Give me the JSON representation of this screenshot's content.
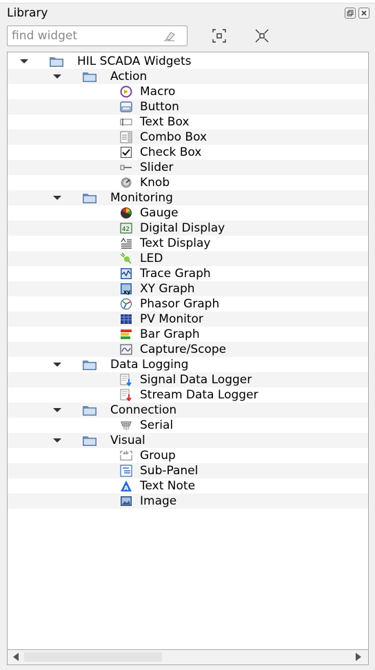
{
  "panel": {
    "title": "Library",
    "search_placeholder": "find widget"
  },
  "tree": [
    {
      "label": "HIL SCADA Widgets",
      "level": 0,
      "type": "folder"
    },
    {
      "label": "Action",
      "level": 1,
      "type": "folder"
    },
    {
      "label": "Macro",
      "level": 2,
      "icon": "macro-icon"
    },
    {
      "label": "Button",
      "level": 2,
      "icon": "button-icon"
    },
    {
      "label": "Text Box",
      "level": 2,
      "icon": "text-box-icon"
    },
    {
      "label": "Combo Box",
      "level": 2,
      "icon": "combo-box-icon"
    },
    {
      "label": "Check Box",
      "level": 2,
      "icon": "check-box-icon"
    },
    {
      "label": "Slider",
      "level": 2,
      "icon": "slider-icon"
    },
    {
      "label": "Knob",
      "level": 2,
      "icon": "knob-icon"
    },
    {
      "label": "Monitoring",
      "level": 1,
      "type": "folder"
    },
    {
      "label": "Gauge",
      "level": 2,
      "icon": "gauge-icon"
    },
    {
      "label": "Digital Display",
      "level": 2,
      "icon": "digital-display-icon"
    },
    {
      "label": "Text Display",
      "level": 2,
      "icon": "text-display-icon"
    },
    {
      "label": "LED",
      "level": 2,
      "icon": "led-icon"
    },
    {
      "label": "Trace Graph",
      "level": 2,
      "icon": "trace-graph-icon"
    },
    {
      "label": "XY Graph",
      "level": 2,
      "icon": "xy-graph-icon"
    },
    {
      "label": "Phasor Graph",
      "level": 2,
      "icon": "phasor-graph-icon"
    },
    {
      "label": "PV Monitor",
      "level": 2,
      "icon": "pv-monitor-icon"
    },
    {
      "label": "Bar Graph",
      "level": 2,
      "icon": "bar-graph-icon"
    },
    {
      "label": "Capture/Scope",
      "level": 2,
      "icon": "capture-scope-icon"
    },
    {
      "label": "Data Logging",
      "level": 1,
      "type": "folder"
    },
    {
      "label": "Signal Data Logger",
      "level": 2,
      "icon": "signal-data-logger-icon"
    },
    {
      "label": "Stream Data Logger",
      "level": 2,
      "icon": "stream-data-logger-icon"
    },
    {
      "label": "Connection",
      "level": 1,
      "type": "folder"
    },
    {
      "label": "Serial",
      "level": 2,
      "icon": "serial-icon"
    },
    {
      "label": "Visual",
      "level": 1,
      "type": "folder"
    },
    {
      "label": "Group",
      "level": 2,
      "icon": "group-icon"
    },
    {
      "label": "Sub-Panel",
      "level": 2,
      "icon": "sub-panel-icon"
    },
    {
      "label": "Text Note",
      "level": 2,
      "icon": "text-note-icon"
    },
    {
      "label": "Image",
      "level": 2,
      "icon": "image-icon"
    }
  ]
}
